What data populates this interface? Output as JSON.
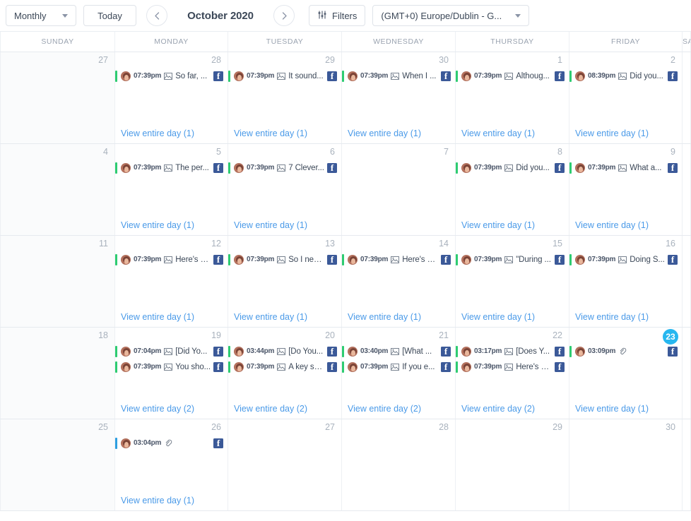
{
  "toolbar": {
    "view_select": {
      "label": "Monthly",
      "icon": "chevron-down-icon"
    },
    "today_button": "Today",
    "prev_label": "‹",
    "next_label": "›",
    "month_title": "October 2020",
    "filters_button": "Filters",
    "filters_icon": "sliders-icon",
    "timezone_select": "(GMT+0) Europe/Dublin - G..."
  },
  "colors": {
    "accent_link": "#4a9ae8",
    "today_badge": "#27b7ef",
    "status_green": "#2ecc71",
    "status_blue": "#2e9fe0",
    "facebook": "#3b5998",
    "daynum": "#a9b2bd",
    "header_text": "#9aa3b0"
  },
  "calendar": {
    "day_headers": [
      "SUNDAY",
      "MONDAY",
      "TUESDAY",
      "WEDNESDAY",
      "THURSDAY",
      "FRIDAY",
      "SATURDAY"
    ],
    "view_day_prefix": "View entire day",
    "weeks": [
      [
        {
          "num": "27",
          "muted": true,
          "events": [],
          "view_day": null
        },
        {
          "num": "28",
          "muted": false,
          "view_day": "View entire day (1)",
          "events": [
            {
              "bar": "green",
              "time": "07:39pm",
              "type": "image-icon",
              "text": "So far, ...",
              "network": "facebook"
            }
          ]
        },
        {
          "num": "29",
          "muted": false,
          "view_day": "View entire day (1)",
          "events": [
            {
              "bar": "green",
              "time": "07:39pm",
              "type": "image-icon",
              "text": "It sound...",
              "network": "facebook"
            }
          ]
        },
        {
          "num": "30",
          "muted": false,
          "view_day": "View entire day (1)",
          "events": [
            {
              "bar": "green",
              "time": "07:39pm",
              "type": "image-icon",
              "text": "When I ...",
              "network": "facebook"
            }
          ]
        },
        {
          "num": "1",
          "muted": false,
          "view_day": "View entire day (1)",
          "events": [
            {
              "bar": "green",
              "time": "07:39pm",
              "type": "image-icon",
              "text": "Althoug...",
              "network": "facebook"
            }
          ]
        },
        {
          "num": "2",
          "muted": false,
          "view_day": "View entire day (1)",
          "events": [
            {
              "bar": "green",
              "time": "08:39pm",
              "type": "image-icon",
              "text": "Did you...",
              "network": "facebook"
            }
          ]
        },
        {
          "num": "",
          "muted": false,
          "events": [],
          "view_day": null
        }
      ],
      [
        {
          "num": "4",
          "muted": true,
          "events": [],
          "view_day": null
        },
        {
          "num": "5",
          "muted": false,
          "view_day": "View entire day (1)",
          "events": [
            {
              "bar": "green",
              "time": "07:39pm",
              "type": "image-icon",
              "text": "The per...",
              "network": "facebook"
            }
          ]
        },
        {
          "num": "6",
          "muted": false,
          "view_day": "View entire day (1)",
          "events": [
            {
              "bar": "green",
              "time": "07:39pm",
              "type": "image-icon",
              "text": "7 Clever...",
              "network": "facebook"
            }
          ]
        },
        {
          "num": "7",
          "muted": false,
          "events": [],
          "view_day": null
        },
        {
          "num": "8",
          "muted": false,
          "view_day": "View entire day (1)",
          "events": [
            {
              "bar": "green",
              "time": "07:39pm",
              "type": "image-icon",
              "text": "Did you...",
              "network": "facebook"
            }
          ]
        },
        {
          "num": "9",
          "muted": false,
          "view_day": "View entire day (1)",
          "events": [
            {
              "bar": "green",
              "time": "07:39pm",
              "type": "image-icon",
              "text": "What a...",
              "network": "facebook"
            }
          ]
        },
        {
          "num": "",
          "muted": false,
          "events": [],
          "view_day": null
        }
      ],
      [
        {
          "num": "11",
          "muted": true,
          "events": [],
          "view_day": null
        },
        {
          "num": "12",
          "muted": false,
          "view_day": "View entire day (1)",
          "events": [
            {
              "bar": "green",
              "time": "07:39pm",
              "type": "image-icon",
              "text": "Here's a...",
              "network": "facebook"
            }
          ]
        },
        {
          "num": "13",
          "muted": false,
          "view_day": "View entire day (1)",
          "events": [
            {
              "bar": "green",
              "time": "07:39pm",
              "type": "image-icon",
              "text": "So I nee...",
              "network": "facebook"
            }
          ]
        },
        {
          "num": "14",
          "muted": false,
          "view_day": "View entire day (1)",
          "events": [
            {
              "bar": "green",
              "time": "07:39pm",
              "type": "image-icon",
              "text": "Here's a...",
              "network": "facebook"
            }
          ]
        },
        {
          "num": "15",
          "muted": false,
          "view_day": "View entire day (1)",
          "events": [
            {
              "bar": "green",
              "time": "07:39pm",
              "type": "image-icon",
              "text": "\"During ...",
              "network": "facebook"
            }
          ]
        },
        {
          "num": "16",
          "muted": false,
          "view_day": "View entire day (1)",
          "events": [
            {
              "bar": "green",
              "time": "07:39pm",
              "type": "image-icon",
              "text": "Doing S...",
              "network": "facebook"
            }
          ]
        },
        {
          "num": "",
          "muted": false,
          "events": [],
          "view_day": null
        }
      ],
      [
        {
          "num": "18",
          "muted": true,
          "events": [],
          "view_day": null
        },
        {
          "num": "19",
          "muted": false,
          "view_day": "View entire day (2)",
          "events": [
            {
              "bar": "green",
              "time": "07:04pm",
              "type": "image-icon",
              "text": "[Did Yo...",
              "network": "facebook"
            },
            {
              "bar": "green",
              "time": "07:39pm",
              "type": "image-icon",
              "text": "You sho...",
              "network": "facebook"
            }
          ]
        },
        {
          "num": "20",
          "muted": false,
          "view_day": "View entire day (2)",
          "events": [
            {
              "bar": "green",
              "time": "03:44pm",
              "type": "image-icon",
              "text": "[Do You...",
              "network": "facebook"
            },
            {
              "bar": "green",
              "time": "07:39pm",
              "type": "image-icon",
              "text": "A key se...",
              "network": "facebook"
            }
          ]
        },
        {
          "num": "21",
          "muted": false,
          "view_day": "View entire day (2)",
          "events": [
            {
              "bar": "green",
              "time": "03:40pm",
              "type": "image-icon",
              "text": "[What ...",
              "network": "facebook"
            },
            {
              "bar": "green",
              "time": "07:39pm",
              "type": "image-icon",
              "text": "If you e...",
              "network": "facebook"
            }
          ]
        },
        {
          "num": "22",
          "muted": false,
          "view_day": "View entire day (2)",
          "events": [
            {
              "bar": "green",
              "time": "03:17pm",
              "type": "image-icon",
              "text": "[Does Y...",
              "network": "facebook"
            },
            {
              "bar": "green",
              "time": "07:39pm",
              "type": "image-icon",
              "text": "Here's a...",
              "network": "facebook"
            }
          ]
        },
        {
          "num": "23",
          "muted": false,
          "today": true,
          "view_day": "View entire day (1)",
          "events": [
            {
              "bar": "green",
              "time": "03:09pm",
              "type": "link-icon",
              "text": "",
              "network": "facebook"
            }
          ]
        },
        {
          "num": "",
          "muted": false,
          "events": [],
          "view_day": null
        }
      ],
      [
        {
          "num": "25",
          "muted": true,
          "events": [],
          "view_day": null
        },
        {
          "num": "26",
          "muted": false,
          "view_day": "View entire day (1)",
          "events": [
            {
              "bar": "blue",
              "time": "03:04pm",
              "type": "link-icon",
              "text": "",
              "network": "facebook"
            }
          ]
        },
        {
          "num": "27",
          "muted": false,
          "events": [],
          "view_day": null
        },
        {
          "num": "28",
          "muted": false,
          "events": [],
          "view_day": null
        },
        {
          "num": "29",
          "muted": false,
          "events": [],
          "view_day": null
        },
        {
          "num": "30",
          "muted": false,
          "events": [],
          "view_day": null
        },
        {
          "num": "",
          "muted": false,
          "events": [],
          "view_day": null
        }
      ]
    ]
  }
}
